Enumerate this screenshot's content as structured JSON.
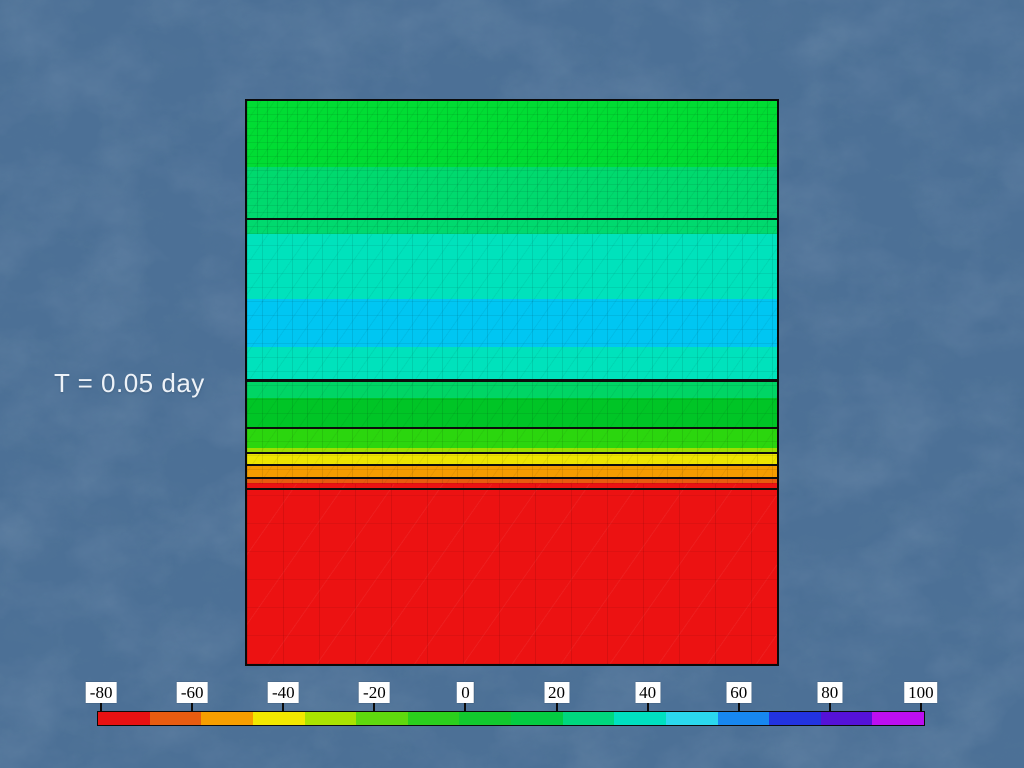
{
  "slide": {
    "time_label": "T = 0.05 day",
    "background_color": "#4C7096",
    "text_color": "#EDF2F8"
  },
  "chart_data": {
    "type": "heatmap",
    "title": "",
    "annotation": "T = 0.05 day",
    "legend_position": "bottom",
    "grid": "triangular mesh overlay",
    "plot_bands": [
      {
        "to_pct": 11.68,
        "color": "#00DC33",
        "approx_value": 15
      },
      {
        "to_pct": 23.54,
        "color": "#00D96E",
        "approx_value": 27
      },
      {
        "to_pct": 35.22,
        "color": "#00E2BC",
        "approx_value": 38
      },
      {
        "to_pct": 43.72,
        "color": "#00C6F2",
        "approx_value": 50
      },
      {
        "to_pct": 49.56,
        "color": "#00E2BC",
        "approx_value": 38
      },
      {
        "to_pct": 52.74,
        "color": "#00D565",
        "approx_value": 27
      },
      {
        "to_pct": 58.05,
        "color": "#00C526",
        "approx_value": 15
      },
      {
        "to_pct": 61.59,
        "color": "#2BD60E",
        "approx_value": 3
      },
      {
        "to_pct": 62.48,
        "color": "#9CDF00",
        "approx_value": -29
      },
      {
        "to_pct": 64.78,
        "color": "#EDE400",
        "approx_value": -41
      },
      {
        "to_pct": 66.73,
        "color": "#F59C00",
        "approx_value": -52
      },
      {
        "to_pct": 67.79,
        "color": "#E85B0E",
        "approx_value": -63
      },
      {
        "to_pct": 100.0,
        "color": "#EC1212",
        "approx_value": -75
      }
    ],
    "contour_lines": [
      {
        "y_pct": 20.88,
        "thickness_px": 2.5
      },
      {
        "y_pct": 49.56,
        "thickness_px": 2.5
      },
      {
        "y_pct": 58.05,
        "thickness_px": 2
      },
      {
        "y_pct": 62.48,
        "thickness_px": 2
      },
      {
        "y_pct": 64.69,
        "thickness_px": 2
      },
      {
        "y_pct": 66.99,
        "thickness_px": 2
      },
      {
        "y_pct": 68.85,
        "thickness_px": 2.5
      }
    ],
    "colorbar": {
      "min": -80,
      "max": 100,
      "ticks": [
        "-80",
        "-60",
        "-40",
        "-20",
        "0",
        "20",
        "40",
        "60",
        "80",
        "100"
      ],
      "colors": [
        "#E81112",
        "#E85C10",
        "#F79E00",
        "#F2E800",
        "#AAE300",
        "#5FD90E",
        "#2BCF1D",
        "#12C92E",
        "#04CC42",
        "#00D77E",
        "#00E0C0",
        "#2BD8EE",
        "#1787F0",
        "#2233E0",
        "#5512D8",
        "#BD0FF0"
      ]
    }
  }
}
